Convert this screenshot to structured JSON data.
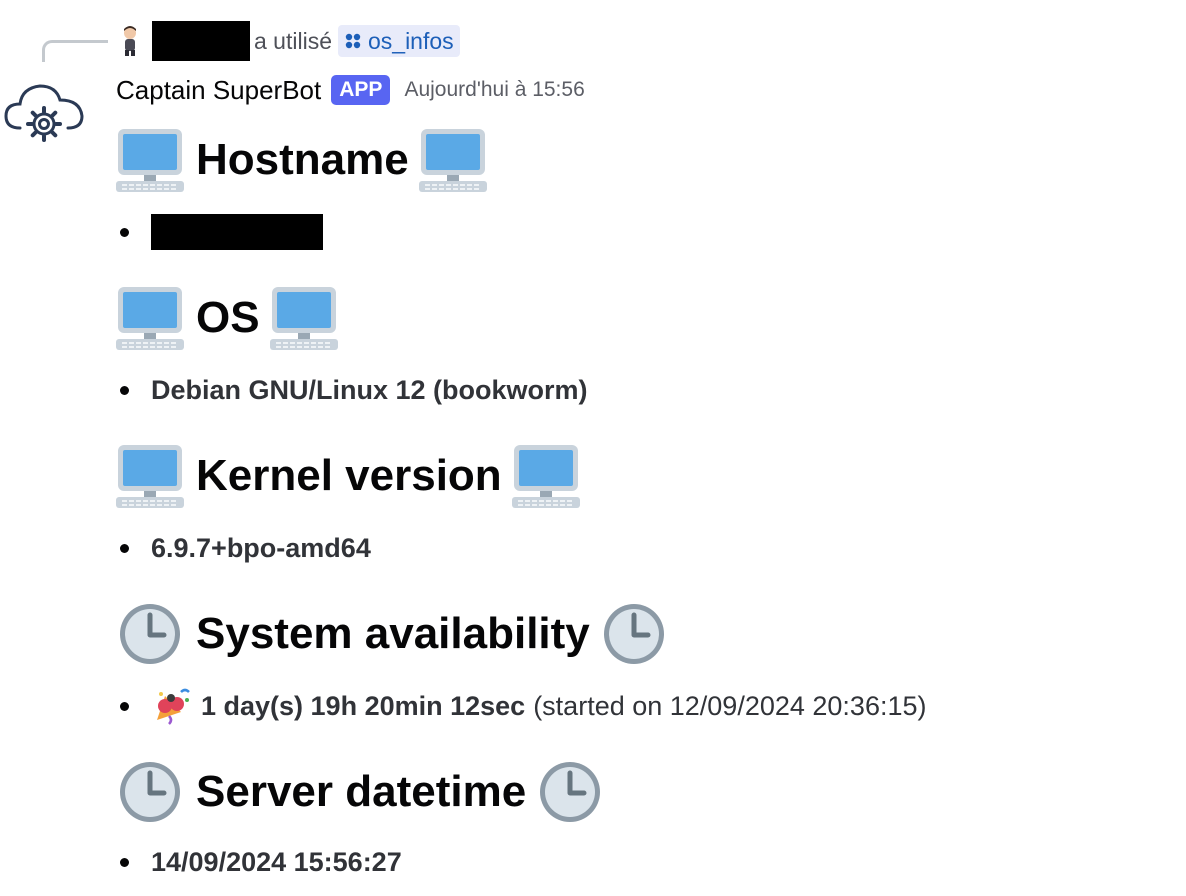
{
  "reply": {
    "action_text": "a utilisé",
    "command_name": "os_infos"
  },
  "message": {
    "bot_name": "Captain SuperBot",
    "badge": "APP",
    "timestamp": "Aujourd'hui à 15:56"
  },
  "sections": {
    "hostname": {
      "heading": "Hostname",
      "icon": "desktop-computer-icon"
    },
    "os": {
      "heading": "OS",
      "icon": "desktop-computer-icon",
      "value": "Debian GNU/Linux 12 (bookworm)"
    },
    "kernel": {
      "heading": "Kernel version",
      "icon": "desktop-computer-icon",
      "value": "6.9.7+bpo-amd64"
    },
    "availability": {
      "heading": "System availability",
      "icon": "clock-icon",
      "value": "1 day(s) 19h 20min 12sec",
      "detail": "(started on 12/09/2024 20:36:15)"
    },
    "datetime": {
      "heading": "Server datetime",
      "icon": "clock-icon",
      "value": "14/09/2024 15:56:27"
    }
  },
  "colors": {
    "badge_bg": "#5865f2",
    "command_bg": "#e8ebfa",
    "command_text": "#1d5fb8",
    "screen_blue": "#5aa9e6",
    "clock_face": "#d9e3ea"
  }
}
